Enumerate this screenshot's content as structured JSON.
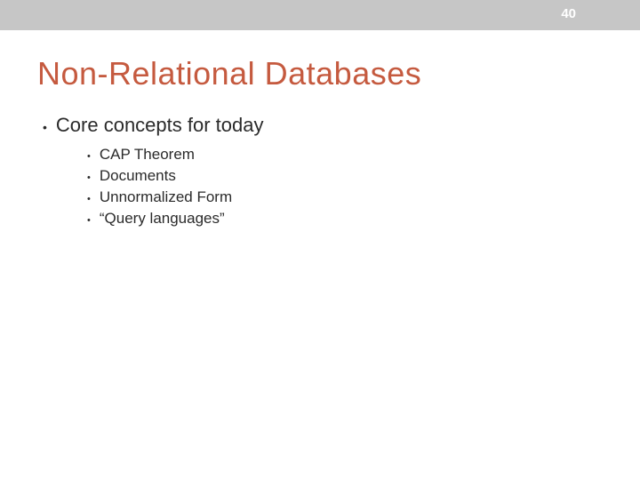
{
  "slide": {
    "number": "40",
    "title": "Non-Relational Databases",
    "bullet_main": "Core concepts for today",
    "sub_bullets": [
      "CAP Theorem",
      "Documents",
      "Unnormalized Form",
      "“Query languages”"
    ]
  }
}
